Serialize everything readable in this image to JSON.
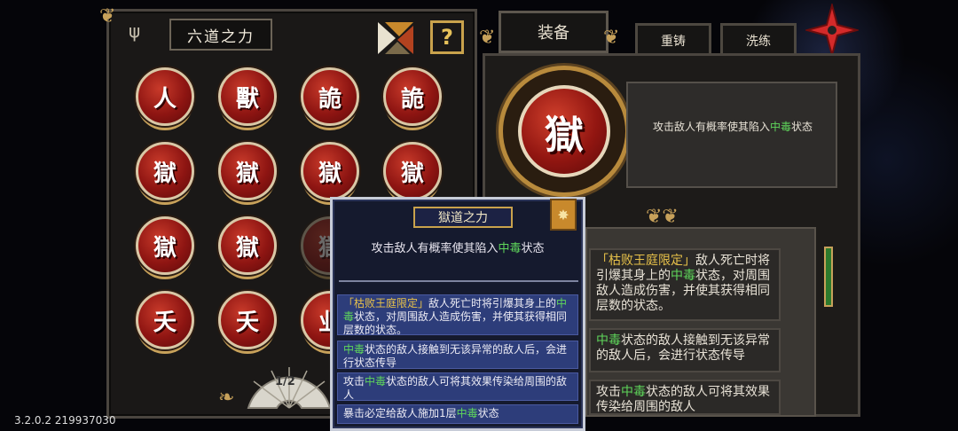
{
  "left": {
    "title": "六道之力",
    "help_label": "?",
    "page_indicator": "1/2",
    "orbs": [
      {
        "glyph": "人",
        "dim": false
      },
      {
        "glyph": "獸",
        "dim": false
      },
      {
        "glyph": "詭",
        "dim": false
      },
      {
        "glyph": "詭",
        "dim": false
      },
      {
        "glyph": "獄",
        "dim": false
      },
      {
        "glyph": "獄",
        "dim": false
      },
      {
        "glyph": "獄",
        "dim": false
      },
      {
        "glyph": "獄",
        "dim": false
      },
      {
        "glyph": "獄",
        "dim": false
      },
      {
        "glyph": "獄",
        "dim": false
      },
      {
        "glyph": "獄",
        "dim": true
      },
      {
        "glyph": "",
        "dim": true
      },
      {
        "glyph": "夭",
        "dim": false
      },
      {
        "glyph": "夭",
        "dim": false
      },
      {
        "glyph": "业",
        "dim": false
      },
      {
        "glyph": "",
        "dim": true
      }
    ]
  },
  "tabs": {
    "equip": "装备",
    "recast": "重铸",
    "wash": "洗练"
  },
  "equipped": {
    "glyph": "獄",
    "desc_pre": "攻击敌人有概率使其陷入",
    "desc_hl": "中毒",
    "desc_post": "状态"
  },
  "right_list": {
    "e1_a": "「枯败王庭限定」",
    "e1_b": "敌人死亡时将引爆其身上的",
    "e1_hl": "中毒",
    "e1_c": "状态，对周围敌人造成伤害，并使其获得相同层数的状态。",
    "e2_hl": "中毒",
    "e2_c": "状态的敌人接触到无该异常的敌人后，会进行状态传导",
    "e3_a": "攻击",
    "e3_hl": "中毒",
    "e3_c": "状态的敌人可将其效果传染给周围的敌人"
  },
  "tooltip": {
    "title": "獄道之力",
    "badge": "✸",
    "desc_pre": "攻击敌人有概率使其陷入",
    "desc_hl": "中毒",
    "desc_post": "状态",
    "entries": [
      {
        "a": "「枯败王庭限定」",
        "b": "敌人死亡时将引爆其身上的",
        "hl": "中毒",
        "c": "状态，对周围敌人造成伤害，并使其获得相同层数的状态。"
      },
      {
        "a": "",
        "b": "",
        "hl": "中毒",
        "c": "状态的敌人接触到无该异常的敌人后，会进行状态传导"
      },
      {
        "a": "",
        "b": "攻击",
        "hl": "中毒",
        "c": "状态的敌人可将其效果传染给周围的敌人"
      },
      {
        "a": "",
        "b": "暴击必定给敌人施加1层",
        "hl": "中毒",
        "c": "状态"
      }
    ]
  },
  "version": "3.2.0.2 219937030",
  "colors": {
    "accent_gold": "#c9a24c",
    "poison_green": "#5fd65b",
    "orb_red": "#921611"
  }
}
